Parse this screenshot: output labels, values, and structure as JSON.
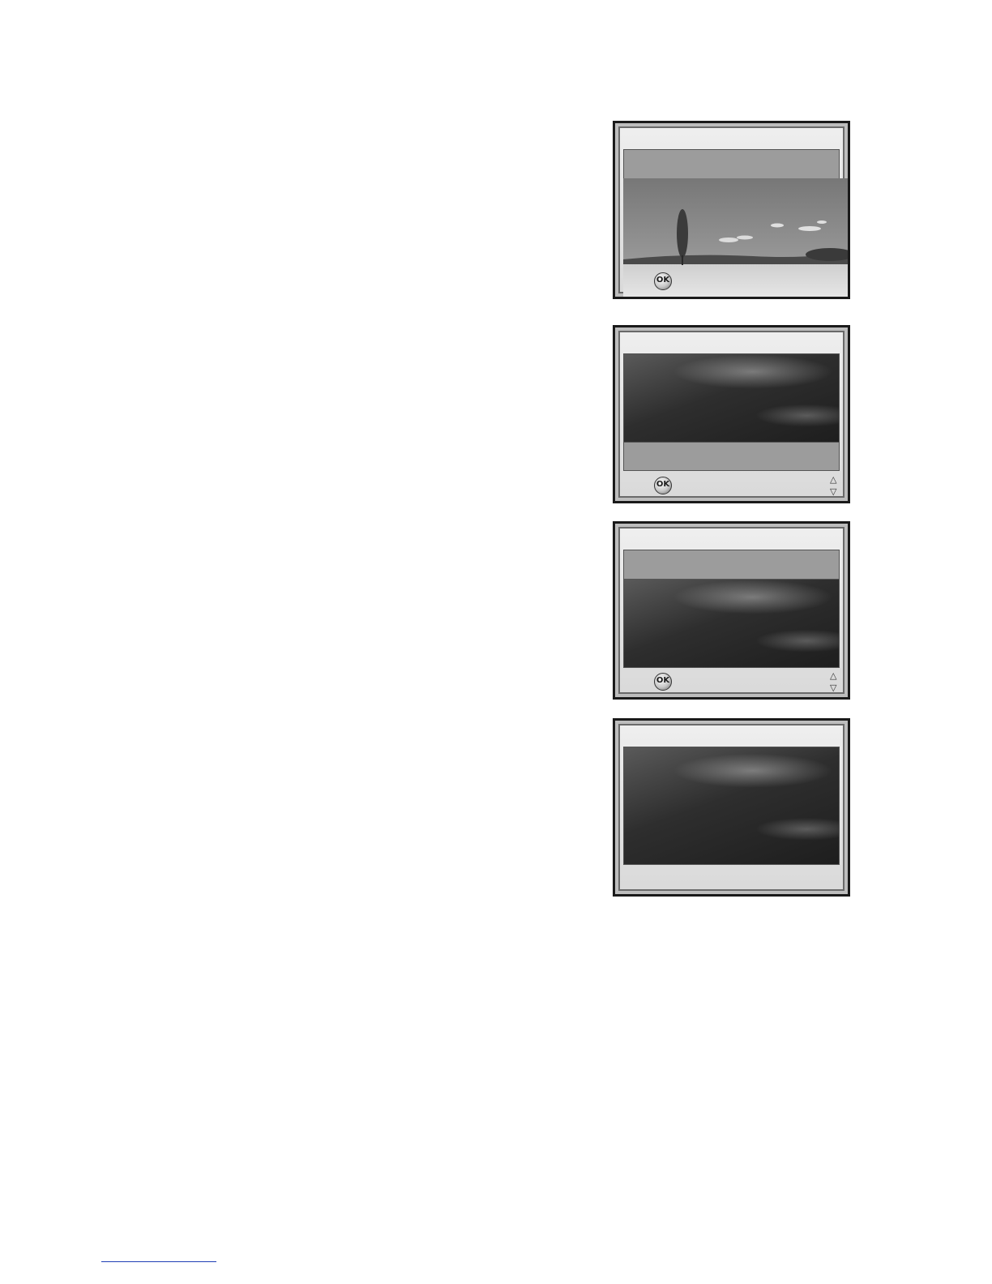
{
  "screens": [
    {
      "ok_label": "OK"
    },
    {
      "ok_label": "OK",
      "arrow_up": "△",
      "arrow_down": "▽"
    },
    {
      "ok_label": "OK",
      "arrow_up": "△",
      "arrow_down": "▽"
    },
    {}
  ],
  "colors": {
    "frame": "#1a1a1a",
    "bar": "#9c9c9c",
    "panel_dark": "#2e2e2e",
    "link": "#1f3fb5"
  },
  "icons": [
    "ok-button-icon",
    "arrow-up-icon",
    "arrow-down-icon"
  ]
}
